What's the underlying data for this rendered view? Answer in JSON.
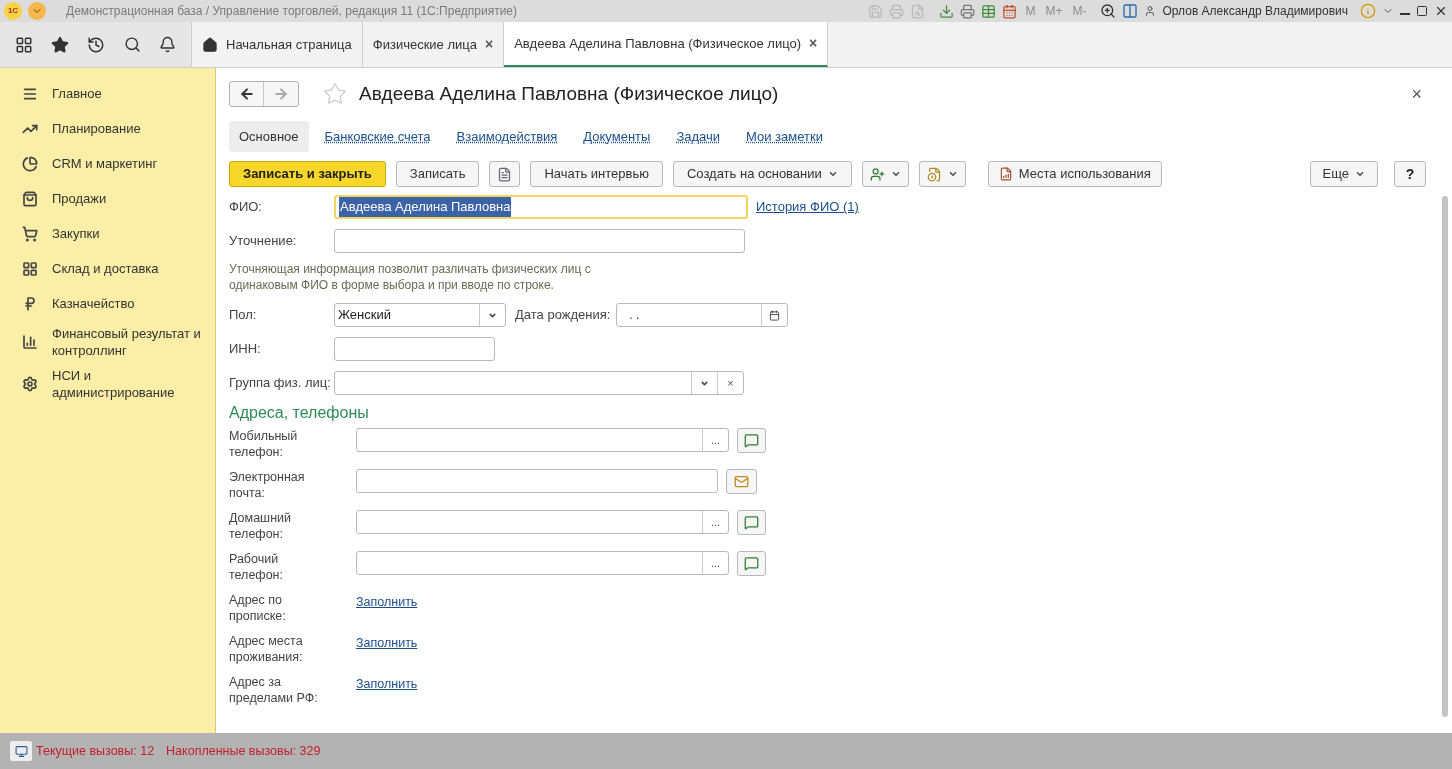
{
  "title_bar": {
    "logo": "1С",
    "title": "Демонстрационная база / Управление торговлей, редакция 11  (1С:Предприятие)",
    "memory_buttons": [
      {
        "label": "M",
        "disabled": true
      },
      {
        "label": "M+",
        "disabled": true
      },
      {
        "label": "M-",
        "disabled": true
      }
    ],
    "user": "Орлов Александр Владимирович"
  },
  "tabs": [
    {
      "label": "Начальная страница",
      "kind": "home",
      "selected": false
    },
    {
      "label": "Физические лица",
      "kind": "page",
      "close": "×",
      "selected": false
    },
    {
      "label": "Авдеева Аделина Павловна (Физическое лицо)",
      "kind": "page",
      "close": "×",
      "selected": true
    }
  ],
  "sidebar": {
    "items": [
      {
        "label": "Главное"
      },
      {
        "label": "Планирование"
      },
      {
        "label": "CRM и маркетинг"
      },
      {
        "label": "Продажи"
      },
      {
        "label": "Закупки"
      },
      {
        "label": "Склад и доставка"
      },
      {
        "label": "Казначейство"
      },
      {
        "label": "Финансовый результат и контроллинг"
      },
      {
        "label": "НСИ и администрирование"
      }
    ]
  },
  "form": {
    "title": "Авдеева Аделина Павловна (Физическое лицо)",
    "close": "×",
    "sections": [
      {
        "label": "Основное",
        "selected": true
      },
      {
        "label": "Банковские счета",
        "selected": false
      },
      {
        "label": "Взаимодействия",
        "selected": false
      },
      {
        "label": "Документы",
        "selected": false
      },
      {
        "label": "Задачи",
        "selected": false
      },
      {
        "label": "Мои заметки",
        "selected": false
      }
    ],
    "buttons": [
      {
        "kind": "primary",
        "label": "Записать и закрыть"
      },
      {
        "kind": "text",
        "label": "Записать"
      },
      {
        "kind": "icon"
      },
      {
        "kind": "text",
        "label": "Начать интервью"
      },
      {
        "kind": "dropdown",
        "label": "Создать на основании"
      },
      {
        "kind": "icon-dropdown"
      },
      {
        "kind": "icon-dropdown"
      },
      {
        "kind": "report",
        "label": "Места использования"
      }
    ],
    "more": "Еще",
    "help": "?",
    "fio": {
      "label": "ФИО:",
      "value": "Авдеева Аделина Павловна",
      "focused": true,
      "link": "История ФИО (1)"
    },
    "clarification": {
      "label": "Уточнение:"
    },
    "hint": "Уточняющая информация позволит различать физических лиц  с одинаковым ФИО в форме выбора и при вводе по строке.",
    "gender": {
      "label": "Пол:",
      "value": "Женский"
    },
    "birth_date": {
      "label": "Дата рождения:",
      "value": ".  ."
    },
    "inn": {
      "label": "ИНН:"
    },
    "group": {
      "label": "Группа физ. лиц:",
      "clear": "×"
    },
    "contacts_header": "Адреса, телефоны",
    "contacts": [
      {
        "kind": "phone",
        "label": "Мобильный телефон:",
        "button": "..."
      },
      {
        "kind": "email",
        "label": "Электронная почта:"
      },
      {
        "kind": "phone",
        "label": "Домашний телефон:",
        "button": "..."
      },
      {
        "kind": "phone",
        "label": "Рабочий телефон:",
        "button": "..."
      },
      {
        "kind": "address",
        "label": "Адрес по прописке:",
        "link": "Заполнить"
      },
      {
        "kind": "address",
        "label": "Адрес места проживания:",
        "link": "Заполнить"
      },
      {
        "kind": "address",
        "label": "Адрес за пределами РФ:",
        "link": "Заполнить"
      }
    ]
  },
  "status_bar": {
    "items": [
      "Текущие вызовы: 12",
      "Накопленные вызовы: 329"
    ]
  }
}
